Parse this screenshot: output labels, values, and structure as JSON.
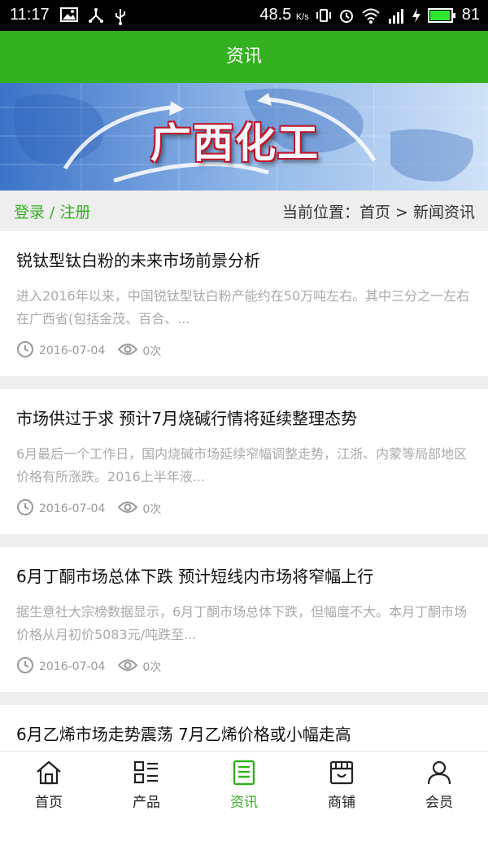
{
  "status_bar": {
    "time": "11:17",
    "net_speed": "48.5",
    "net_unit": "K/s",
    "battery": "81"
  },
  "header": {
    "title": "资讯"
  },
  "banner": {
    "text": "广西化工"
  },
  "location_bar": {
    "login": "登录",
    "separator": " / ",
    "register": "注册",
    "prefix": "当前位置：",
    "home": "首页",
    "arrow": " > ",
    "current": "新闻资讯"
  },
  "articles": [
    {
      "title": "锐钛型钛白粉的未来市场前景分析",
      "summary": "进入2016年以来，中国锐钛型钛白粉产能约在50万吨左右。其中三分之一左右在广西省(包括金茂、百合、...",
      "date": "2016-07-04",
      "views": "0次"
    },
    {
      "title": "市场供过于求 预计7月烧碱行情将延续整理态势",
      "summary": "6月最后一个工作日，国内烧碱市场延续窄幅调整走势，江浙、内蒙等局部地区价格有所涨跌。2016上半年液...",
      "date": "2016-07-04",
      "views": "0次"
    },
    {
      "title": "6月丁酮市场总体下跌 预计短线内市场将窄幅上行",
      "summary": "据生意社大宗榜数据显示，6月丁酮市场总体下跌，但幅度不大。本月丁酮市场价格从月初价5083元/吨跌至...",
      "date": "2016-07-04",
      "views": "0次"
    },
    {
      "title": "6月乙烯市场走势震荡 7月乙烯价格或小幅走高",
      "summary": "",
      "date": "",
      "views": ""
    }
  ],
  "tabs": [
    {
      "label": "首页",
      "icon": "home-icon"
    },
    {
      "label": "产品",
      "icon": "grid-list-icon"
    },
    {
      "label": "资讯",
      "icon": "news-icon"
    },
    {
      "label": "商铺",
      "icon": "shop-icon"
    },
    {
      "label": "会员",
      "icon": "person-icon"
    }
  ],
  "colors": {
    "accent": "#33b11e",
    "text": "#111111",
    "muted": "#aaaaaa"
  }
}
